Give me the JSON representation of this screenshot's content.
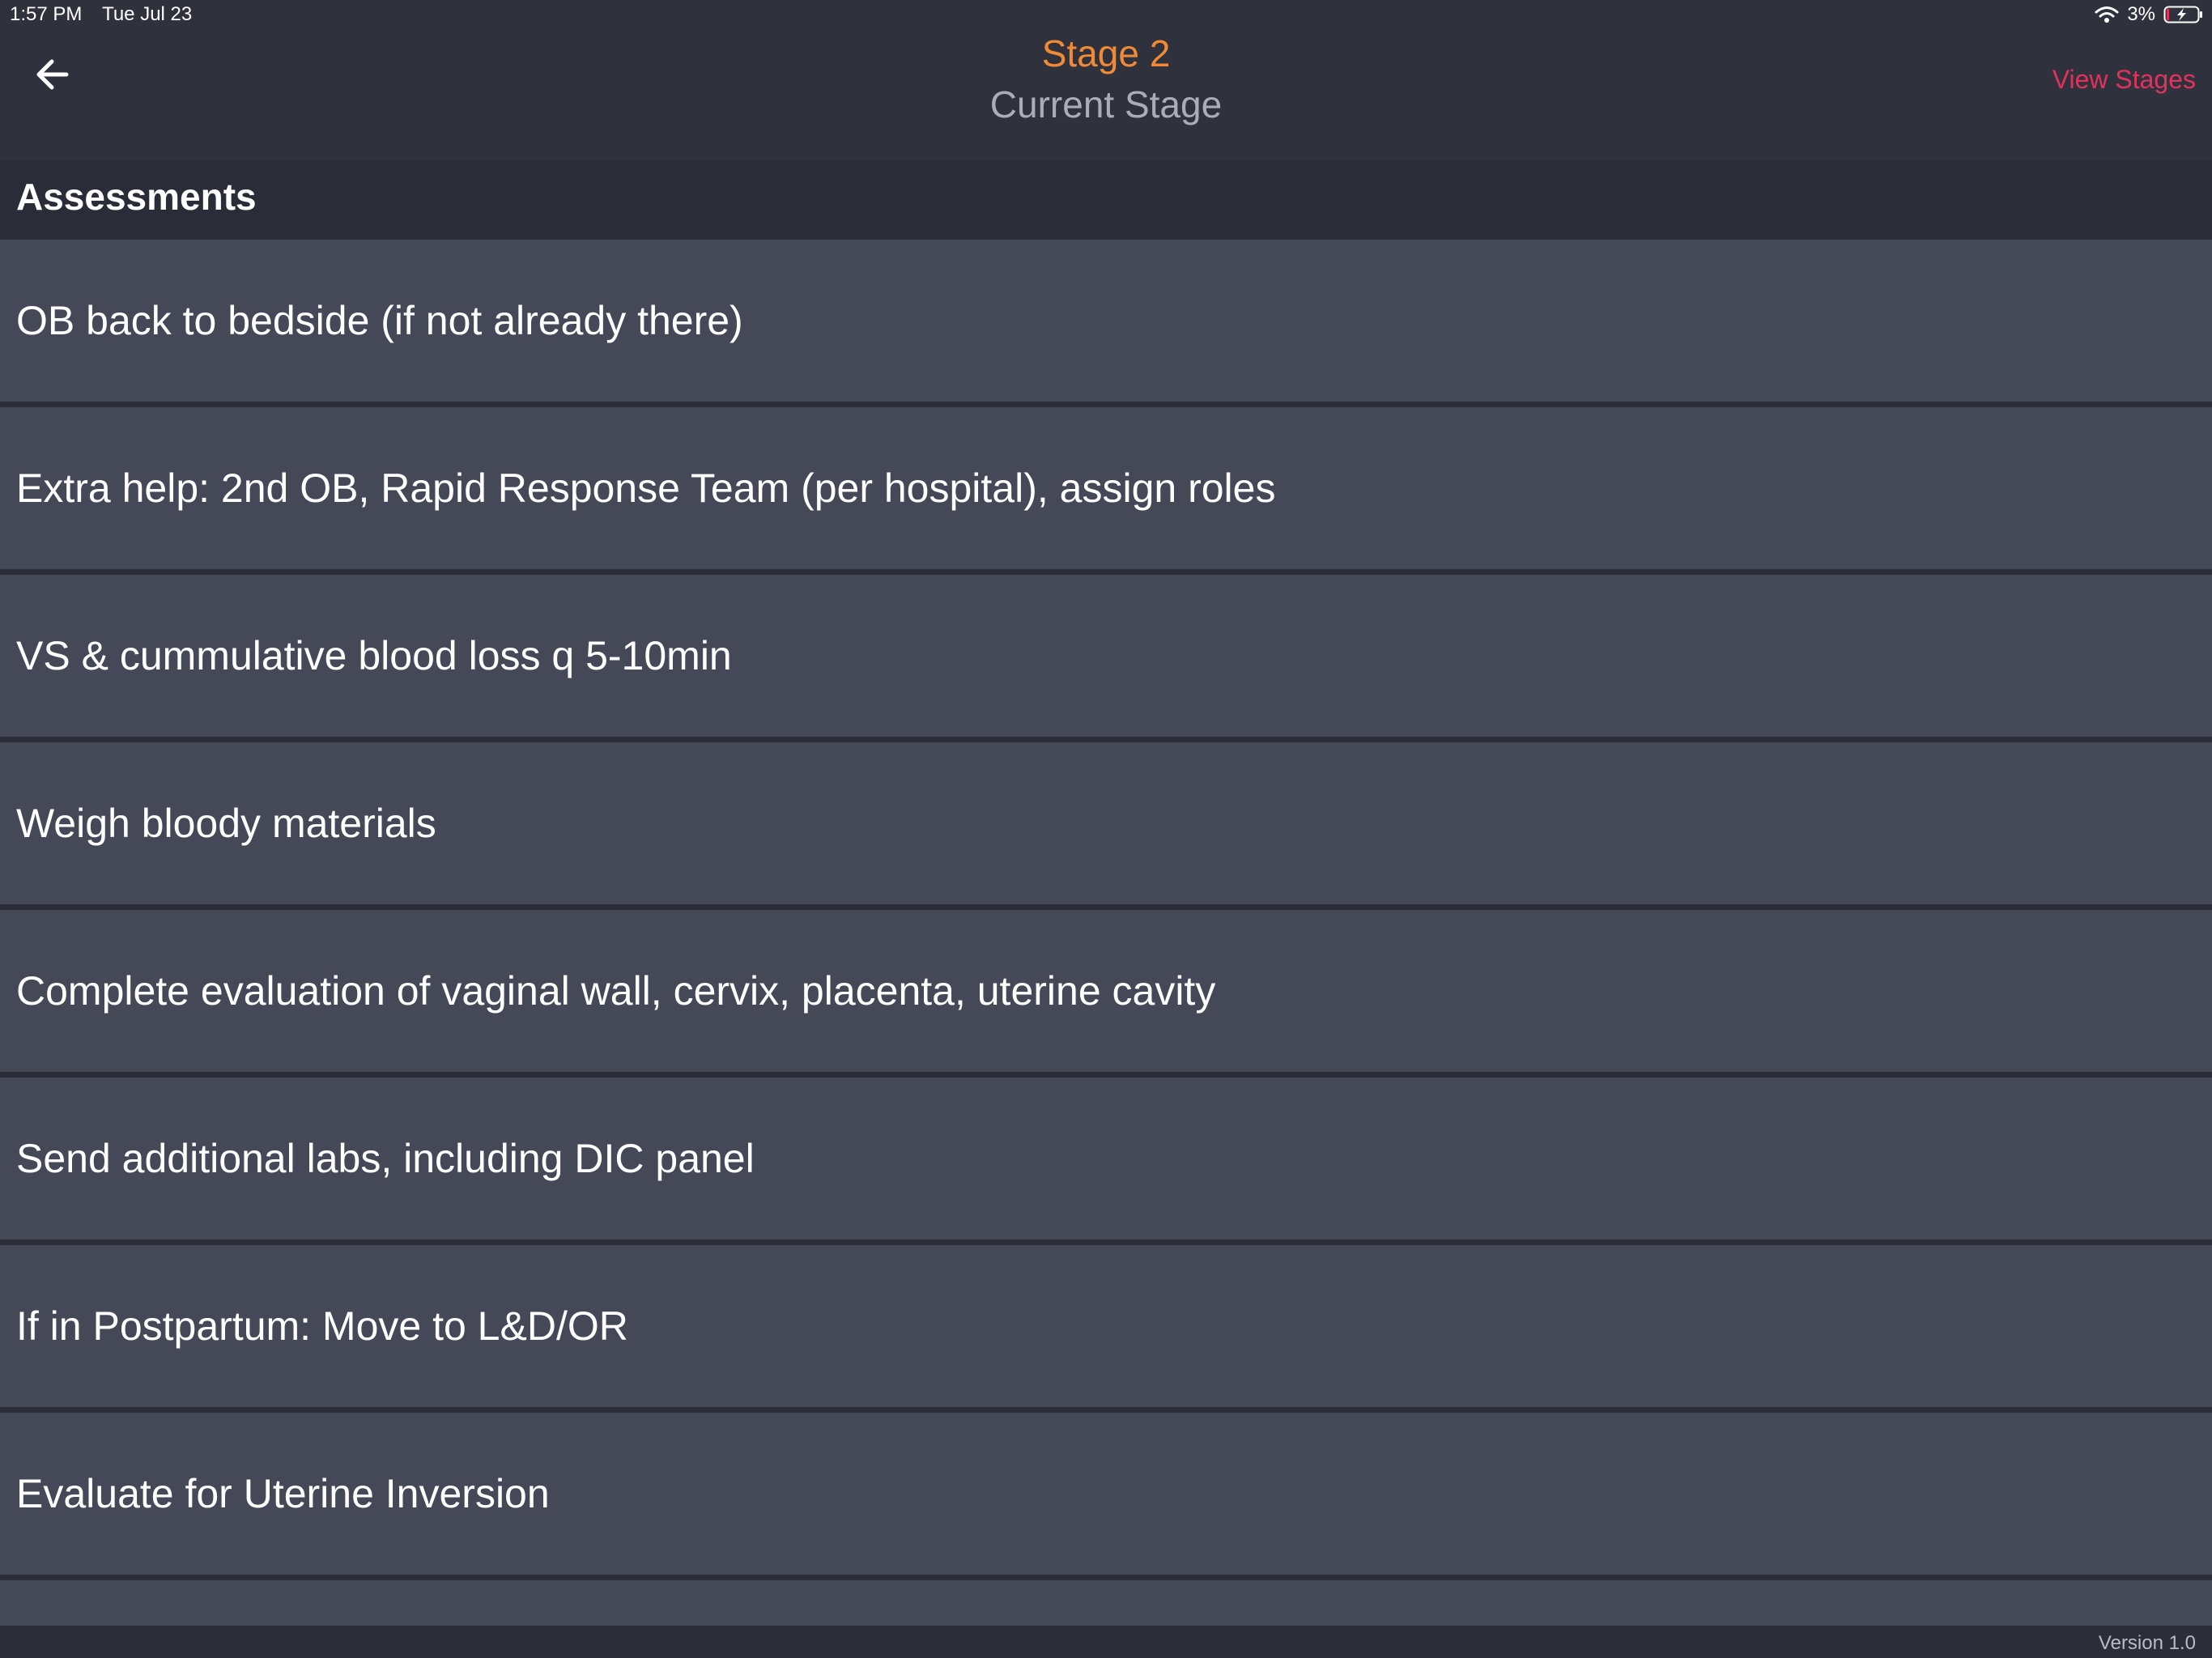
{
  "status_bar": {
    "time": "1:57 PM",
    "date": "Tue Jul 23",
    "battery_percent": "3%",
    "wifi_icon": "wifi-icon",
    "battery_icon": "battery-charging-icon"
  },
  "header": {
    "back_icon": "arrow-left-icon",
    "title": "Stage 2",
    "subtitle": "Current Stage",
    "view_stages_label": "View Stages",
    "colors": {
      "title": "#f08a36",
      "link": "#e2325c"
    }
  },
  "section": {
    "title": "Assessments"
  },
  "items": [
    {
      "label": "OB back to bedside (if not already there)"
    },
    {
      "label": "Extra help: 2nd OB, Rapid Response Team (per hospital), assign roles"
    },
    {
      "label": "VS & cummulative blood loss q 5-10min"
    },
    {
      "label": "Weigh bloody materials"
    },
    {
      "label": "Complete evaluation of vaginal wall, cervix, placenta, uterine cavity"
    },
    {
      "label": "Send additional labs, including DIC panel"
    },
    {
      "label": "If in Postpartum: Move to L&D/OR"
    },
    {
      "label": "Evaluate for Uterine Inversion"
    }
  ],
  "footer": {
    "version": "Version 1.0"
  }
}
